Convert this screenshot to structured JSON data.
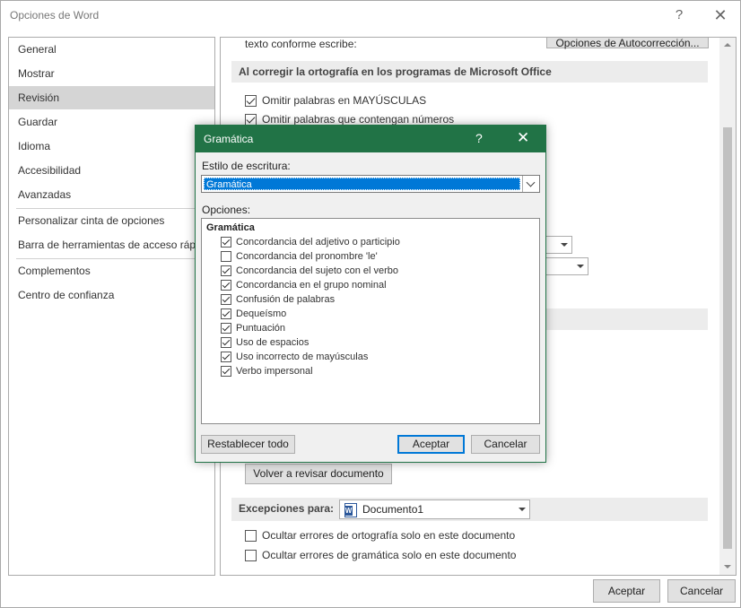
{
  "window": {
    "title": "Opciones de Word",
    "help_glyph": "?",
    "close_glyph": "✕"
  },
  "nav": {
    "items": [
      {
        "label": "General"
      },
      {
        "label": "Mostrar"
      },
      {
        "label": "Revisión",
        "selected": true
      },
      {
        "label": "Guardar"
      },
      {
        "label": "Idioma"
      },
      {
        "label": "Accesibilidad"
      },
      {
        "label": "Avanzadas"
      },
      {
        "label": "Personalizar cinta de opciones"
      },
      {
        "label": "Barra de herramientas de acceso rápido"
      },
      {
        "label": "Complementos"
      },
      {
        "label": "Centro de confianza"
      }
    ]
  },
  "content": {
    "partial_text": "texto conforme escribe:",
    "autocorrect_button": "Opciones de Autocorrección...",
    "section_spelling": "Al corregir la ortografía en los programas de Microsoft Office",
    "opt_uppercase": {
      "label": "Omitir palabras en MAYÚSCULAS",
      "checked": true
    },
    "opt_numbers": {
      "label": "Omitir palabras que contengan números",
      "checked": true
    },
    "recheck_button": "Volver a revisar documento",
    "exceptions_label": "Excepciones para:",
    "exceptions_doc": "Documento1",
    "opt_hide_spelling": {
      "label": "Ocultar errores de ortografía solo en este documento",
      "checked": false
    },
    "opt_hide_grammar": {
      "label": "Ocultar errores de gramática solo en este documento",
      "checked": false
    }
  },
  "footer": {
    "accept": "Aceptar",
    "cancel": "Cancelar"
  },
  "modal": {
    "title": "Gramática",
    "help_glyph": "?",
    "close_glyph": "✕",
    "style_label": "Estilo de escritura:",
    "style_value": "Gramática",
    "options_label": "Opciones:",
    "group_label": "Gramática",
    "items": [
      {
        "label": "Concordancia del adjetivo o participio",
        "checked": true
      },
      {
        "label": "Concordancia del pronombre 'le'",
        "checked": false
      },
      {
        "label": "Concordancia del sujeto con el verbo",
        "checked": true
      },
      {
        "label": "Concordancia en el grupo nominal",
        "checked": true
      },
      {
        "label": "Confusión de palabras",
        "checked": true
      },
      {
        "label": "Dequeísmo",
        "checked": true
      },
      {
        "label": "Puntuación",
        "checked": true
      },
      {
        "label": "Uso de espacios",
        "checked": true
      },
      {
        "label": "Uso incorrecto de mayúsculas",
        "checked": true
      },
      {
        "label": "Verbo impersonal",
        "checked": true
      }
    ],
    "reset_button": "Restablecer todo",
    "accept_button": "Aceptar",
    "cancel_button": "Cancelar"
  },
  "colors": {
    "modal_accent": "#217346",
    "selection_blue": "#0078d7",
    "nav_selected": "#d5d5d5"
  }
}
